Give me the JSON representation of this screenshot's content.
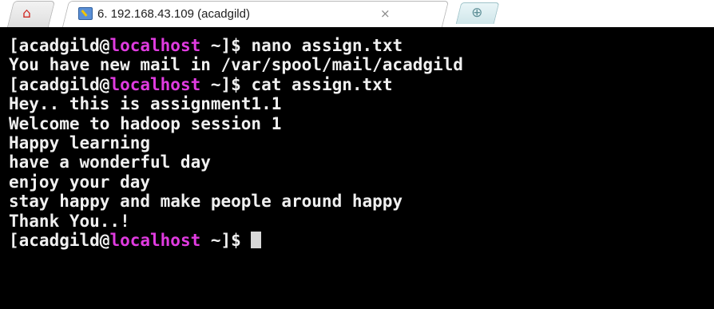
{
  "tabs": {
    "home_icon": "home-icon",
    "session_label": "6. 192.168.43.109 (acadgild)",
    "close_glyph": "×",
    "new_tab_icon": "new-tab-icon"
  },
  "colors": {
    "terminal_background": "#000000",
    "terminal_text": "#f0f0f0",
    "hostname": "#e03be0"
  },
  "terminal": {
    "prompt": {
      "user_part": "[acadgild@",
      "host": "localhost",
      "suffix": " ~]$ "
    },
    "lines": [
      {
        "type": "prompt",
        "command": "nano assign.txt"
      },
      {
        "type": "output",
        "text": "You have new mail in /var/spool/mail/acadgild"
      },
      {
        "type": "prompt",
        "command": "cat assign.txt"
      },
      {
        "type": "output",
        "text": "Hey.. this is assignment1.1"
      },
      {
        "type": "output",
        "text": "Welcome to hadoop session 1"
      },
      {
        "type": "output",
        "text": "Happy learning"
      },
      {
        "type": "output",
        "text": "have a wonderful day"
      },
      {
        "type": "output",
        "text": "enjoy your day"
      },
      {
        "type": "output",
        "text": "stay happy and make people around happy"
      },
      {
        "type": "output",
        "text": "Thank You..!"
      },
      {
        "type": "prompt",
        "command": ""
      }
    ]
  }
}
